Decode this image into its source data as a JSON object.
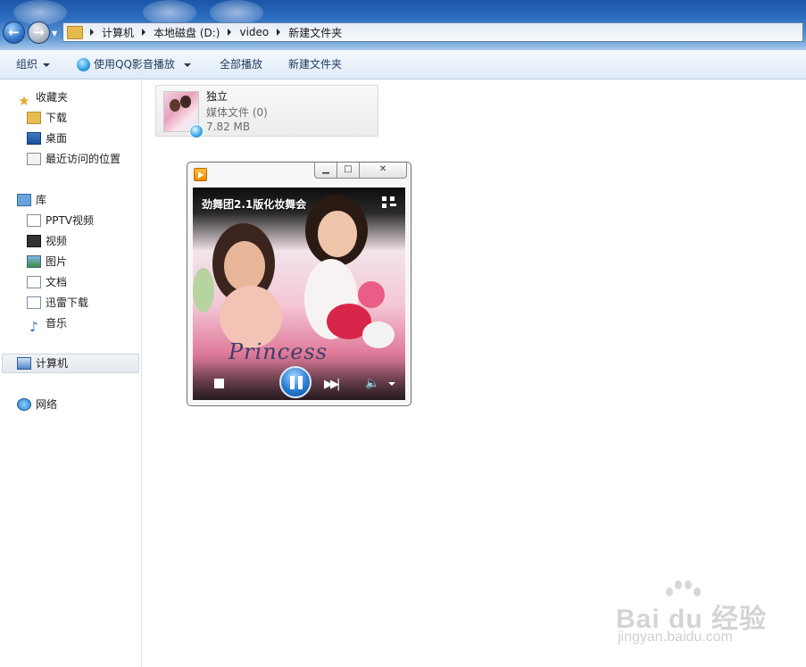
{
  "address_bar": {
    "crumbs": [
      "计算机",
      "本地磁盘 (D:)",
      "video",
      "新建文件夹"
    ]
  },
  "toolbar": {
    "organize": "组织",
    "play_with": "使用QQ影音播放",
    "play_all": "全部播放",
    "new_folder": "新建文件夹"
  },
  "nav": {
    "favorites": {
      "label": "收藏夹",
      "items": [
        "下载",
        "桌面",
        "最近访问的位置"
      ]
    },
    "libraries": {
      "label": "库",
      "items": [
        "PPTV视频",
        "视频",
        "图片",
        "文档",
        "迅雷下载",
        "音乐"
      ]
    },
    "computer": "计算机",
    "network": "网络"
  },
  "file": {
    "name": "独立",
    "type": "媒体文件 (0)",
    "size": "7.82 MB"
  },
  "player": {
    "title": "劲舞团2.1版化妆舞会",
    "overlay_text": "Princess"
  },
  "watermark": {
    "brand": "Bai du 经验",
    "url": "jingyan.baidu.com"
  },
  "colors": {
    "titlebar": "#2c6cbf",
    "toolbar": "#dfeaf7",
    "player_accent": "#2a7cd0",
    "player_logo": "#f08a00"
  }
}
